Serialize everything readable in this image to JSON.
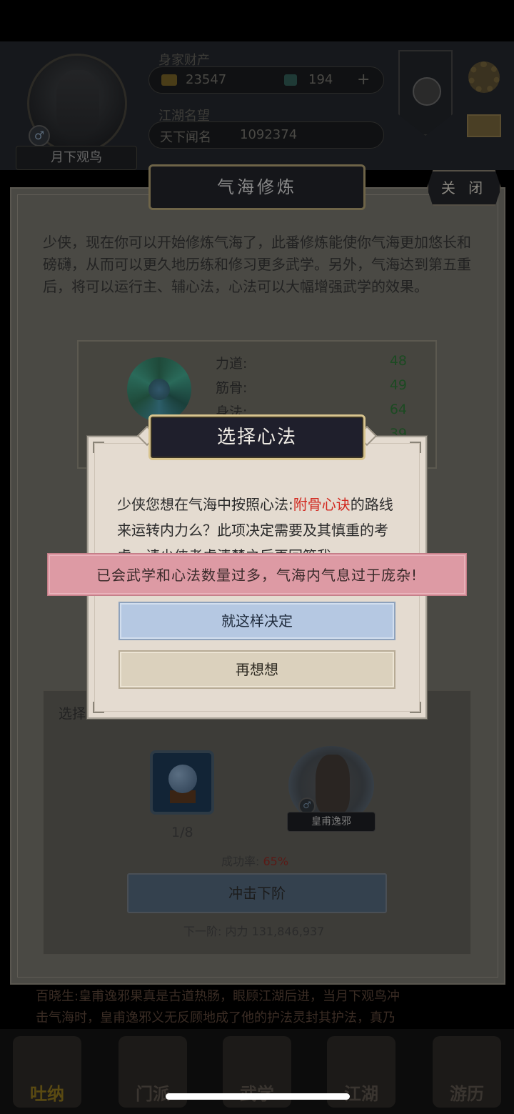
{
  "hud": {
    "player_name": "月下观鸟",
    "gender_symbol": "♂",
    "wealth_label": "身家财产",
    "gold": "23547",
    "jade": "194",
    "plus": "+",
    "fame_label": "江湖名望",
    "fame_title": "天下闻名",
    "fame_value": "1092374"
  },
  "main_panel": {
    "title": "气海修炼",
    "close_label": "关 闭",
    "intro": "少侠，现在你可以开始修炼气海了，此番修炼能使你气海更加悠长和磅礴，从而可以更久地历练和修习更多武学。另外，气海达到第五重后，将可以运行主、辅心法，心法可以大幅增强武学的效果。",
    "stats": [
      {
        "label": "力道:",
        "value": "48"
      },
      {
        "label": "筋骨:",
        "value": "49"
      },
      {
        "label": "身法:",
        "value": "64"
      },
      {
        "label": "",
        "value": "39"
      }
    ],
    "choose_label": "选择",
    "item_count": "1/8",
    "character_name": "皇甫逸邪",
    "success_rate_label": "成功率: ",
    "success_rate_value": "65%",
    "charge_button": "冲击下阶",
    "next_tier": "下一阶: 内力 131,846,937"
  },
  "news": {
    "line1": "百晓生:皇甫逸邪果真是古道热肠，眼顾江湖后进，当月下观鸟冲",
    "line2": "击气海时，皇甫逸邪义无反顾地成了他的护法灵封其护法，真乃"
  },
  "bottom_nav": [
    {
      "label": "吐纳",
      "active": true
    },
    {
      "label": "门派",
      "active": false
    },
    {
      "label": "武学",
      "active": false
    },
    {
      "label": "江湖",
      "active": false
    },
    {
      "label": "游历",
      "active": false
    }
  ],
  "modal": {
    "title": "选择心法",
    "body_prefix": "少侠您想在气海中按照心法:",
    "body_highlight": "附骨心诀",
    "body_suffix": "的路线来运转内力么？此项决定需要及其慎重的考虑，请少侠考虑清楚之后再回答我。",
    "confirm_label": "就这样决定",
    "rethink_label": "再想想"
  },
  "toast": {
    "message": "已会武学和心法数量过多，气海内气息过于庞杂!"
  },
  "colors": {
    "highlight_red": "#d1281f",
    "confirm_blue": "#b5c8e2",
    "toast_pink": "#dd9aa4",
    "modal_bg": "#e4dbd0"
  }
}
